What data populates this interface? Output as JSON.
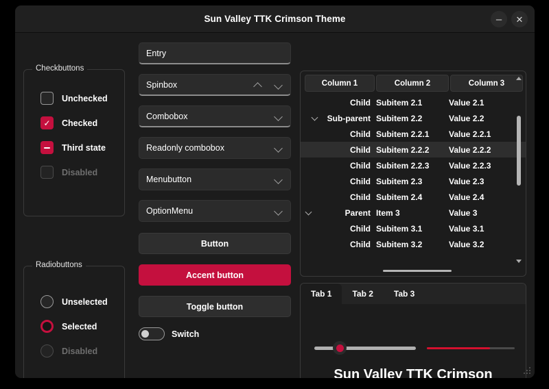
{
  "window": {
    "title": "Sun Valley TTK Crimson Theme",
    "minimize_label": "–",
    "close_label": "✕",
    "accent_color": "#c4103e",
    "progress_color": "#d4102e",
    "background_color": "#1c1c1c"
  },
  "checkbuttons": {
    "frame_title": "Checkbuttons",
    "items": [
      {
        "label": "Unchecked",
        "state": "unchecked"
      },
      {
        "label": "Checked",
        "state": "checked"
      },
      {
        "label": "Third state",
        "state": "third"
      },
      {
        "label": "Disabled",
        "state": "disabled"
      }
    ]
  },
  "radiobuttons": {
    "frame_title": "Radiobuttons",
    "items": [
      {
        "label": "Unselected",
        "state": "unselected"
      },
      {
        "label": "Selected",
        "state": "selected"
      },
      {
        "label": "Disabled",
        "state": "disabled"
      }
    ]
  },
  "inputs": {
    "entry_value": "Entry",
    "spinbox_value": "Spinbox",
    "combobox_value": "Combobox",
    "readonly_combobox_value": "Readonly combobox",
    "menubutton_label": "Menubutton",
    "optionmenu_label": "OptionMenu"
  },
  "buttons": {
    "button_label": "Button",
    "accent_label": "Accent button",
    "toggle_label": "Toggle button",
    "switch_label": "Switch",
    "switch_state": "off"
  },
  "treeview": {
    "columns": [
      "Column 1",
      "Column 2",
      "Column 3"
    ],
    "selected_row_index": 3,
    "rows": [
      {
        "indent": 2,
        "expander": false,
        "c1": "Child",
        "c2": "Subitem 2.1",
        "c3": "Value 2.1"
      },
      {
        "indent": 1,
        "expander": true,
        "c1": "Sub-parent",
        "c2": "Subitem 2.2",
        "c3": "Value 2.2"
      },
      {
        "indent": 3,
        "expander": false,
        "c1": "Child",
        "c2": "Subitem 2.2.1",
        "c3": "Value 2.2.1"
      },
      {
        "indent": 3,
        "expander": false,
        "c1": "Child",
        "c2": "Subitem 2.2.2",
        "c3": "Value 2.2.2"
      },
      {
        "indent": 3,
        "expander": false,
        "c1": "Child",
        "c2": "Subitem 2.2.3",
        "c3": "Value 2.2.3"
      },
      {
        "indent": 2,
        "expander": false,
        "c1": "Child",
        "c2": "Subitem 2.3",
        "c3": "Value 2.3"
      },
      {
        "indent": 2,
        "expander": false,
        "c1": "Child",
        "c2": "Subitem 2.4",
        "c3": "Value 2.4"
      },
      {
        "indent": 0,
        "expander": true,
        "c1": "Parent",
        "c2": "Item 3",
        "c3": "Value 3"
      },
      {
        "indent": 2,
        "expander": false,
        "c1": "Child",
        "c2": "Subitem 3.1",
        "c3": "Value 3.1"
      },
      {
        "indent": 2,
        "expander": false,
        "c1": "Child",
        "c2": "Subitem 3.2",
        "c3": "Value 3.2"
      }
    ]
  },
  "notebook": {
    "tabs": [
      {
        "label": "Tab 1",
        "active": true
      },
      {
        "label": "Tab 2",
        "active": false
      },
      {
        "label": "Tab 3",
        "active": false
      }
    ],
    "scale_percent": 25,
    "progress_percent": 72,
    "heading": "Sun Valley TTK Crimson"
  }
}
